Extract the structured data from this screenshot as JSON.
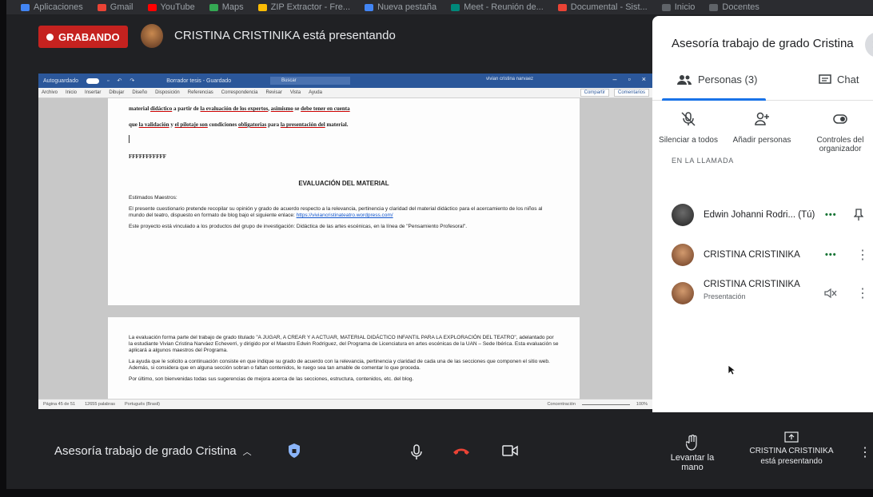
{
  "bookmarks": [
    {
      "label": "Aplicaciones",
      "color": "#4285f4"
    },
    {
      "label": "Gmail",
      "color": "#ea4335"
    },
    {
      "label": "YouTube",
      "color": "#ff0000"
    },
    {
      "label": "Maps",
      "color": "#34a853"
    },
    {
      "label": "ZIP Extractor - Fre...",
      "color": "#fbbc04"
    },
    {
      "label": "Nueva pestaña",
      "color": "#4285f4"
    },
    {
      "label": "Meet - Reunión de...",
      "color": "#00897b"
    },
    {
      "label": "Documental - Sist...",
      "color": "#ea4335"
    },
    {
      "label": "Inicio",
      "color": "#5f6368"
    },
    {
      "label": "Docentes",
      "color": "#5f6368"
    }
  ],
  "header": {
    "recording_label": "GRABANDO",
    "presenting_text": "CRISTINA CRISTINIKA está presentando"
  },
  "word": {
    "title_left": "Autoguardado",
    "title_doc": "Borrador tesis - Guardado",
    "search_placeholder": "Buscar",
    "user": "vivian cristina narvaez",
    "ribbon_tabs": [
      "Archivo",
      "Inicio",
      "Insertar",
      "Dibujar",
      "Diseño",
      "Disposición",
      "Referencias",
      "Correspondencia",
      "Revisar",
      "Vista",
      "Ayuda"
    ],
    "share_label": "Compartir",
    "comments_label": "Comentarios",
    "page1": {
      "line1_a": "material ",
      "line1_b": "didáctico",
      "line1_c": " a partir de ",
      "line1_d": "la evaluación de los expertos",
      "line1_e": ", ",
      "line1_f": "asimismo",
      "line1_g": " se ",
      "line1_h": "debe tener en cuenta",
      "line2_a": "que ",
      "line2_b": "la validación",
      "line2_c": " y ",
      "line2_d": "el pilotaje son",
      "line2_e": " condiciones ",
      "line2_f": "obligatorias",
      "line2_g": " para ",
      "line2_h": "la presentación del",
      "line2_i": " material.",
      "fff": "FFFFFFFFFFF",
      "eval_title": "EVALUACIÓN DEL MATERIAL",
      "greeting": "Estimados Maestros:",
      "para1": "El presente cuestionario pretende recopilar su opinión y grado de acuerdo respecto a la relevancia, pertinencia y claridad del material didáctico para el acercamiento de los niños al mundo del teatro, dispuesto en formato de blog bajo el siguiente enlace: ",
      "link": "https://viviancristinateatro.wordpress.com/",
      "para2": "Este proyecto está vinculado a los productos del grupo de investigación: Didáctica de las artes escénicas, en la línea de \"Pensamiento Profesoral\"."
    },
    "page2": {
      "para1": "La evaluación forma parte del trabajo de grado titulado \"A JUGAR, A CREAR Y A ACTUAR, MATERIAL DIDÁCTICO INFANTIL PARA LA EXPLORACIÓN DEL TEATRO\", adelantado por la estudiante Vivian Cristina Narváez Echeverri, y dirigido por el Maestro Edwin Rodríguez, del Programa de Licenciatura en artes escénicas de la UAN – Sede Ibérica. Esta evaluación se aplicará a algunos maestros del Programa.",
      "para2": "La ayuda que le solicito a continuación consiste en que indique su grado de acuerdo con la relevancia, pertinencia y claridad de cada una de las secciones que componen el sitio web. Además, si considera que en alguna sección sobran o faltan contenidos, le ruego sea tan amable de comentar lo que proceda.",
      "para3": "Por último, son bienvenidas todas sus sugerencias de mejora acerca de las secciones, estructura, contenidos, etc. del blog."
    },
    "status": {
      "page": "Página 45 de 51",
      "words": "12655 palabras",
      "lang": "Português (Brasil)",
      "focus": "Concentración",
      "zoom": "100%"
    }
  },
  "panel": {
    "title": "Asesoría trabajo de grado Cristina",
    "tabs": {
      "people": "Personas (3)",
      "chat": "Chat"
    },
    "actions": [
      {
        "label": "Silenciar a todos",
        "icon": "mute-all-icon"
      },
      {
        "label": "Añadir personas",
        "icon": "add-person-icon"
      },
      {
        "label": "Controles del organizador",
        "icon": "host-controls-icon"
      }
    ],
    "section_label": "EN LA LLAMADA",
    "participants": [
      {
        "name": "Edwin Johanni Rodri... (Tú)",
        "sub": "",
        "avatar_color": "#4a4a4a"
      },
      {
        "name": "CRISTINA CRISTINIKA",
        "sub": "",
        "avatar_color": "#a0654a"
      },
      {
        "name": "CRISTINA CRISTINIKA",
        "sub": "Presentación",
        "avatar_color": "#a0654a"
      }
    ]
  },
  "bottom": {
    "meeting_name": "Asesoría trabajo de grado Cristina",
    "raise_hand": "Levantar la mano",
    "presenting_line1": "CRISTINA CRISTINIKA",
    "presenting_line2": "está presentando"
  },
  "colors": {
    "recording": "#c5221f",
    "accent": "#1a73e8",
    "hangup": "#ea4335",
    "word_blue": "#2b579a"
  }
}
